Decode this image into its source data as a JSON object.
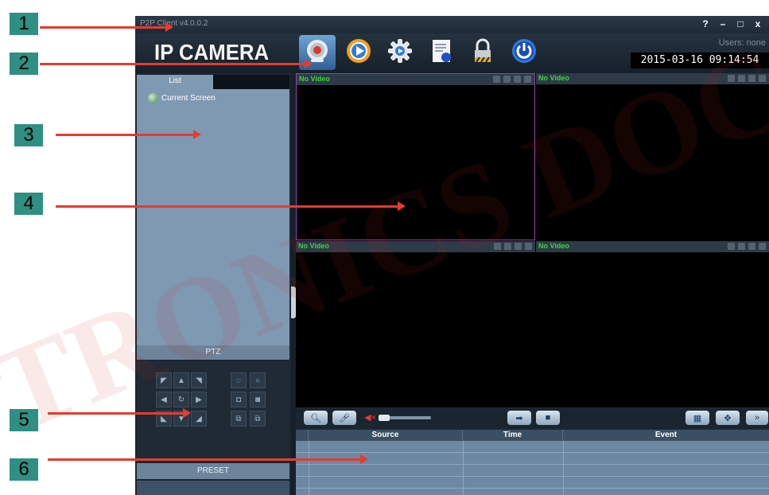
{
  "app": {
    "title_version": "P2P Client v4.0.0.2",
    "logo": "IP CAMERA",
    "users_label": "Users: none",
    "datetime": "2015-03-16 09:14:54",
    "window_controls": [
      "?",
      "–",
      "□",
      "x"
    ]
  },
  "toolbar": {
    "buttons": [
      {
        "icon": "camera-icon",
        "active": true
      },
      {
        "icon": "playback-icon",
        "active": false
      },
      {
        "icon": "settings-gear-icon",
        "active": false
      },
      {
        "icon": "log-document-icon",
        "active": false
      },
      {
        "icon": "lock-icon",
        "active": false
      },
      {
        "icon": "power-icon",
        "active": false
      }
    ]
  },
  "sidebar": {
    "list_tab": "List",
    "tree_item": "Current Screen",
    "ptz_label": "PTZ",
    "preset_label": "PRESET"
  },
  "video": {
    "panels": [
      {
        "label": "No Video"
      },
      {
        "label": "No Video"
      },
      {
        "label": "No Video"
      },
      {
        "label": "No Video"
      }
    ]
  },
  "log": {
    "columns": [
      "Source",
      "Time",
      "Event"
    ],
    "rows": []
  },
  "callouts": [
    "1",
    "2",
    "3",
    "4",
    "5",
    "6"
  ],
  "colors": {
    "accent_blue": "#6fa4d8",
    "video_label_green": "#39d83a",
    "selected_border": "#9b3fb0",
    "callout_teal": "#2f8f82",
    "arrow_red": "#e53b2f"
  }
}
